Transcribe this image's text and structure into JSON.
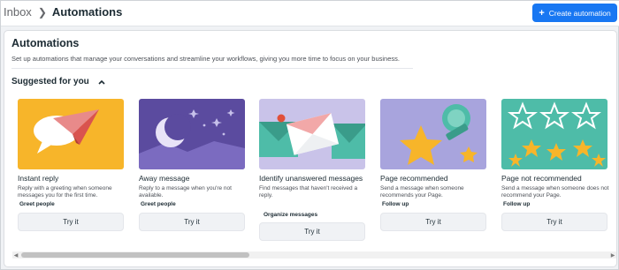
{
  "header": {
    "breadcrumb_root": "Inbox",
    "breadcrumb_current": "Automations",
    "create_button": "Create automation"
  },
  "panel": {
    "title": "Automations",
    "subtitle": "Set up automations that manage your conversations and streamline your workflows, giving you more time to focus on your business.",
    "suggested_label": "Suggested for you"
  },
  "cards": [
    {
      "title": "Instant reply",
      "description": "Reply with a greeting when someone messages you for the first time.",
      "category": "Greet people",
      "button": "Try it"
    },
    {
      "title": "Away message",
      "description": "Reply to a message when you're not available.",
      "category": "Greet people",
      "button": "Try it"
    },
    {
      "title": "Identify unanswered messages",
      "description": "Find messages that haven't received a reply.",
      "category": "Organize messages",
      "button": "Try it"
    },
    {
      "title": "Page recommended",
      "description": "Send a message when someone recommends your Page.",
      "category": "Follow up",
      "button": "Try it"
    },
    {
      "title": "Page not recommended",
      "description": "Send a message when someone does not recommend your Page.",
      "category": "Follow up",
      "button": "Try it"
    }
  ],
  "colors": {
    "primary": "#1877f2",
    "instant_bg": "#f7b52a",
    "away_bg": "#5b4b9f",
    "unanswered_bg": "#c9c3e9",
    "recommended_bg": "#a8a4dd",
    "not_recommended_bg": "#4ebca8"
  }
}
